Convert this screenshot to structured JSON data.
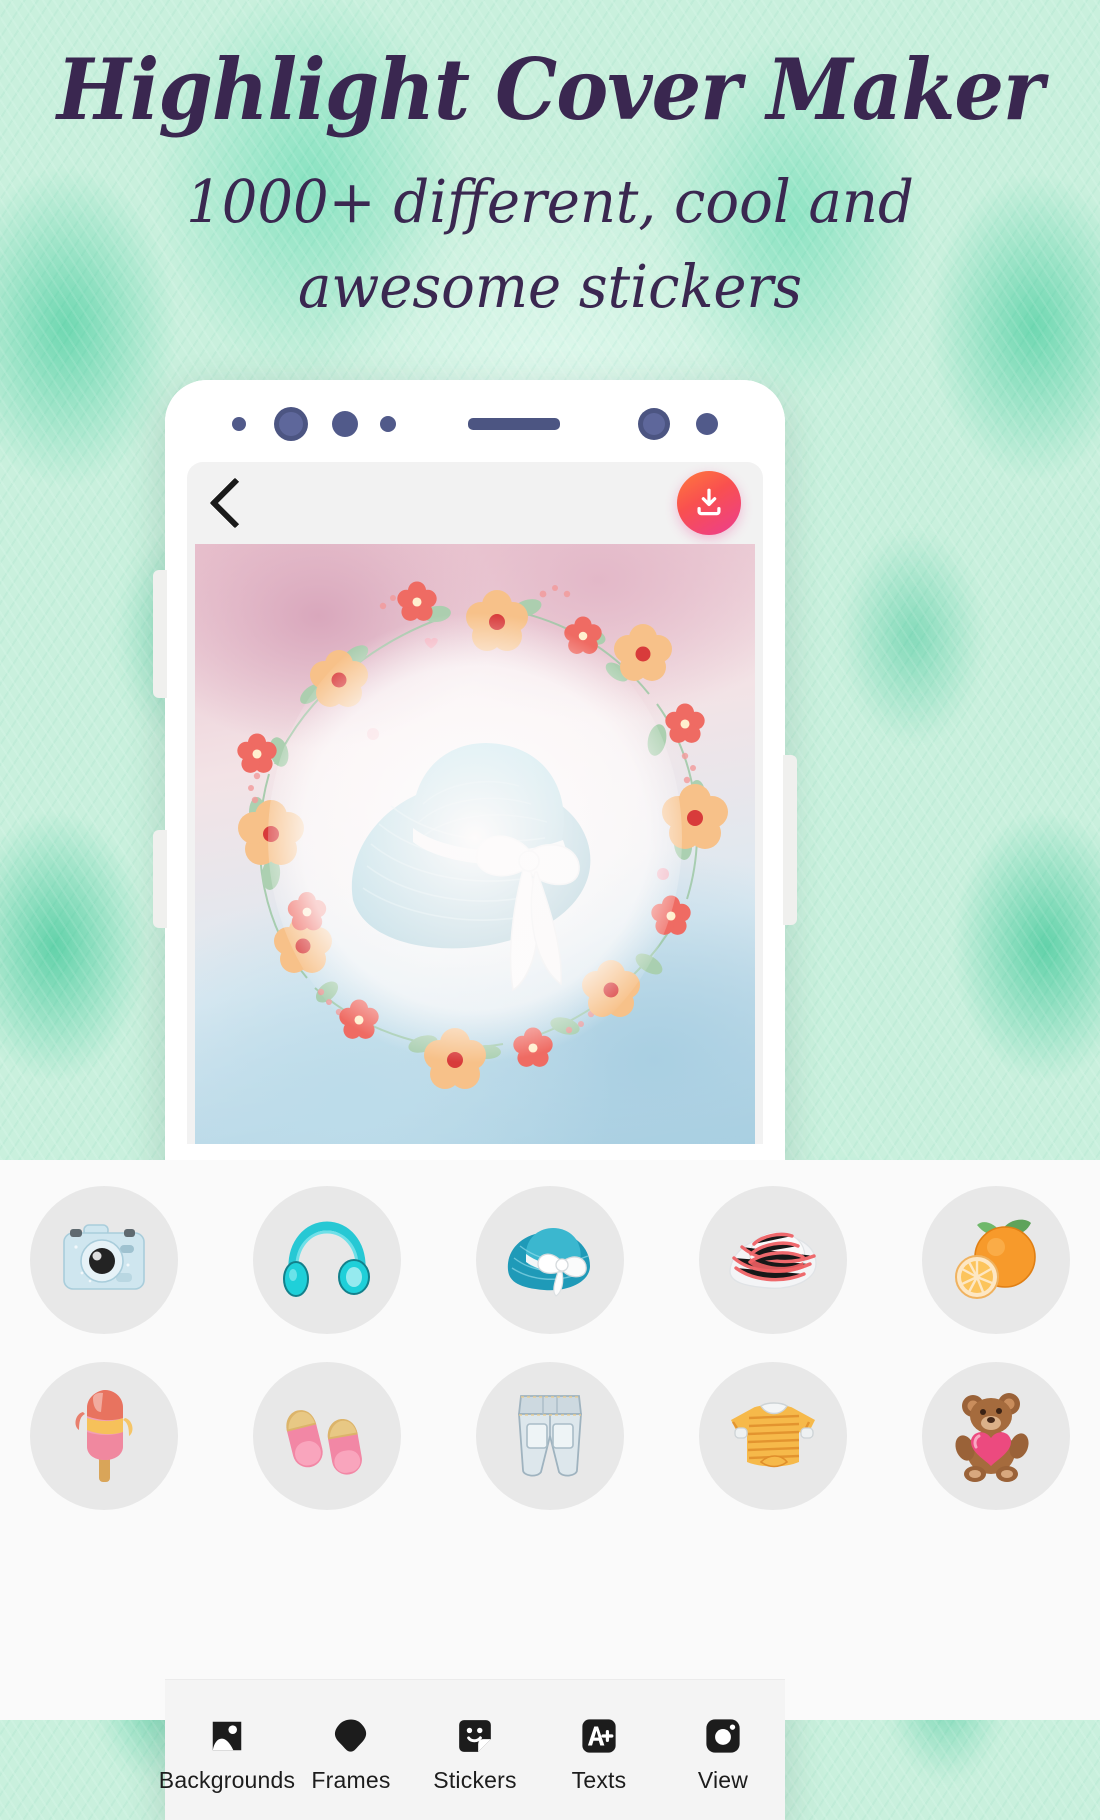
{
  "header": {
    "title": "Highlight Cover Maker",
    "tagline": "1000+ different, cool and awesome stickers"
  },
  "colors": {
    "background_mint": "#c9f0dd",
    "headline_purple": "#3a2750",
    "download_gradient_start": "#ff7a3d",
    "download_gradient_end": "#ec3d8f",
    "phone_body": "#ffffff",
    "appbar": "#f2f2f2",
    "sticker_circle": "#e8e8e8",
    "nav_bar": "#f4f4f4"
  },
  "phone": {
    "status_dots": [
      "small-dot",
      "ring-dot",
      "medium-dot",
      "small-dot",
      "speaker-bar",
      "ring-dot",
      "medium-dot"
    ],
    "appbar": {
      "back_icon": "chevron-left-icon",
      "download_icon": "download-icon"
    },
    "canvas": {
      "artwork": "watercolor-floral-wreath-with-blue-sun-hat"
    }
  },
  "sticker_panel": {
    "rows": [
      [
        {
          "name": "camera-sticker",
          "label": "Camera"
        },
        {
          "name": "headphones-sticker",
          "label": "Headphones"
        },
        {
          "name": "blue-hat-sticker",
          "label": "Blue Hat"
        },
        {
          "name": "red-striped-hat-sticker",
          "label": "Red Striped Hat"
        },
        {
          "name": "orange-sticker",
          "label": "Orange"
        }
      ],
      [
        {
          "name": "popsicle-sticker",
          "label": "Popsicle"
        },
        {
          "name": "sandals-sticker",
          "label": "Sandals"
        },
        {
          "name": "denim-shorts-sticker",
          "label": "Denim Shorts"
        },
        {
          "name": "striped-tshirt-sticker",
          "label": "Striped T-Shirt"
        },
        {
          "name": "teddy-bear-sticker",
          "label": "Teddy Bear"
        }
      ]
    ]
  },
  "bottom_nav": {
    "items": [
      {
        "label": "Backgrounds",
        "icon": "image-icon"
      },
      {
        "label": "Frames",
        "icon": "blob-frame-icon"
      },
      {
        "label": "Stickers",
        "icon": "sticker-face-icon"
      },
      {
        "label": "Texts",
        "icon": "a-plus-icon"
      },
      {
        "label": "View",
        "icon": "camera-view-icon"
      }
    ]
  }
}
